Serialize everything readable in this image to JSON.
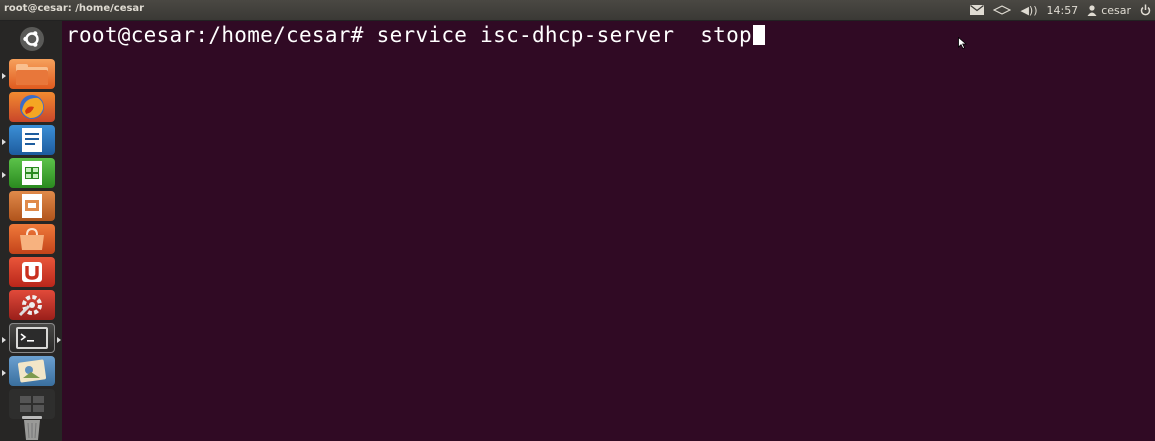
{
  "window": {
    "title": "root@cesar: /home/cesar"
  },
  "panel": {
    "indicators": [
      {
        "name": "mail-icon"
      },
      {
        "name": "network-icon"
      },
      {
        "name": "volume-icon",
        "label": "◀))"
      },
      {
        "name": "clock",
        "label": "14:57"
      },
      {
        "name": "user-menu",
        "label": "cesar"
      },
      {
        "name": "power-icon"
      }
    ],
    "time": "14:57",
    "user": "cesar"
  },
  "launcher": {
    "items": [
      {
        "name": "dash-home",
        "icon": "ubuntu-logo-icon"
      },
      {
        "name": "files",
        "icon": "folder-icon",
        "running": true
      },
      {
        "name": "firefox",
        "icon": "firefox-icon"
      },
      {
        "name": "libreoffice-writer",
        "icon": "writer-icon",
        "running": true
      },
      {
        "name": "libreoffice-calc",
        "icon": "calc-icon",
        "running": true
      },
      {
        "name": "libreoffice-impress",
        "icon": "impress-icon"
      },
      {
        "name": "software-center",
        "icon": "shopping-bag-icon"
      },
      {
        "name": "ubuntu-one",
        "icon": "ubuntu-one-icon"
      },
      {
        "name": "system-settings",
        "icon": "settings-icon"
      },
      {
        "name": "terminal",
        "icon": "terminal-icon",
        "running": true,
        "active": true
      },
      {
        "name": "image-viewer",
        "icon": "image-viewer-icon",
        "running": true
      },
      {
        "name": "workspace-switcher",
        "icon": "workspaces-icon"
      },
      {
        "name": "trash",
        "icon": "trash-icon"
      }
    ]
  },
  "terminal": {
    "prompt": "root@cesar:/home/cesar# ",
    "command": "service isc-dhcp-server  stop",
    "colors": {
      "background": "#300a24",
      "foreground": "#ffffff"
    }
  }
}
